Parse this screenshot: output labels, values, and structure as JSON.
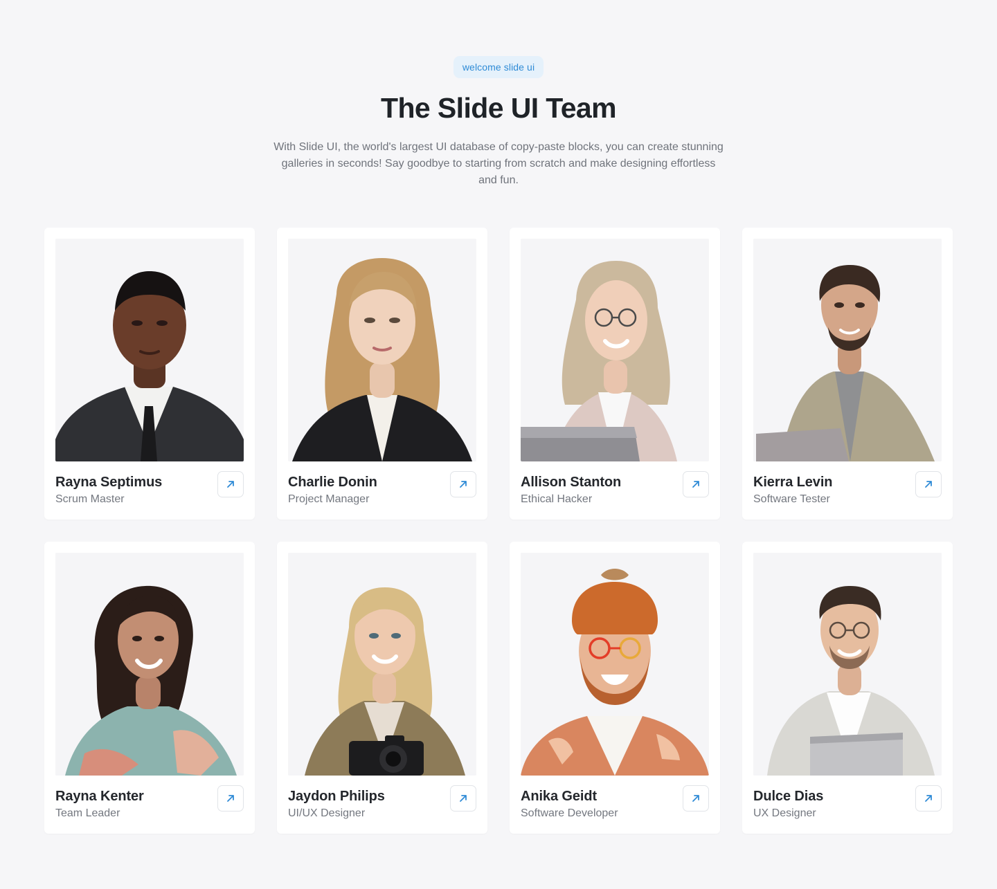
{
  "hero": {
    "badge": "welcome slide ui",
    "title": "The Slide UI Team",
    "subtitle": "With Slide UI, the world's largest UI database of copy-paste blocks, you can create stunning galleries in seconds! Say goodbye to starting from scratch and make designing effortless and fun."
  },
  "colors": {
    "page_background": "#f6f6f8",
    "accent": "#2f8bd6",
    "badge_background": "#e5f1fb",
    "title_text": "#1f2328",
    "muted_text": "#6f737b"
  },
  "team": [
    {
      "name": "Rayna Septimus",
      "role": "Scrum Master",
      "photo_icon": "person-photo-icon",
      "link_icon": "arrow-up-right-icon"
    },
    {
      "name": "Charlie Donin",
      "role": "Project Manager",
      "photo_icon": "person-photo-icon",
      "link_icon": "arrow-up-right-icon"
    },
    {
      "name": "Allison Stanton",
      "role": "Ethical Hacker",
      "photo_icon": "person-photo-icon",
      "link_icon": "arrow-up-right-icon"
    },
    {
      "name": "Kierra Levin",
      "role": "Software Tester",
      "photo_icon": "person-photo-icon",
      "link_icon": "arrow-up-right-icon"
    },
    {
      "name": "Rayna Kenter",
      "role": "Team Leader",
      "photo_icon": "person-photo-icon",
      "link_icon": "arrow-up-right-icon"
    },
    {
      "name": "Jaydon Philips",
      "role": "UI/UX Designer",
      "photo_icon": "person-photo-icon",
      "link_icon": "arrow-up-right-icon"
    },
    {
      "name": "Anika Geidt",
      "role": "Software Developer",
      "photo_icon": "person-photo-icon",
      "link_icon": "arrow-up-right-icon"
    },
    {
      "name": "Dulce Dias",
      "role": "UX Designer",
      "photo_icon": "person-photo-icon",
      "link_icon": "arrow-up-right-icon"
    }
  ]
}
